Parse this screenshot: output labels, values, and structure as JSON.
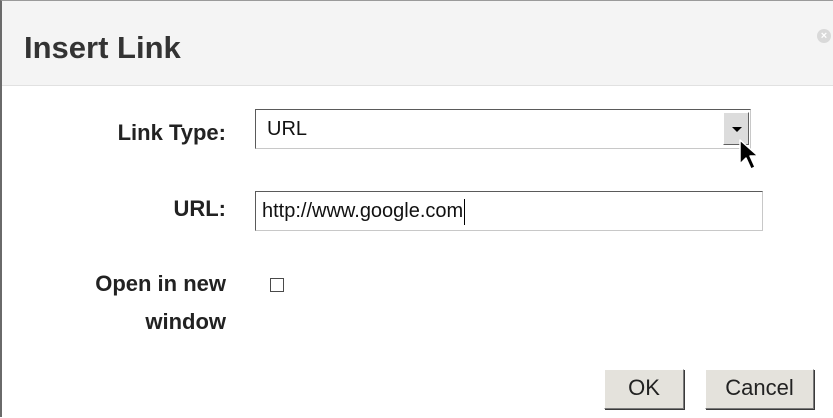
{
  "dialog": {
    "title": "Insert Link",
    "close_icon": "close-icon"
  },
  "form": {
    "link_type_label": "Link Type:",
    "link_type_value": "URL",
    "url_label": "URL:",
    "url_value": "http://www.google.com",
    "new_window_label_line1": "Open in new",
    "new_window_label_line2": "window",
    "new_window_checked": false
  },
  "buttons": {
    "ok": "OK",
    "cancel": "Cancel"
  },
  "icons": {
    "dropdown": "chevron-down-icon",
    "cursor": "mouse-pointer-icon"
  }
}
